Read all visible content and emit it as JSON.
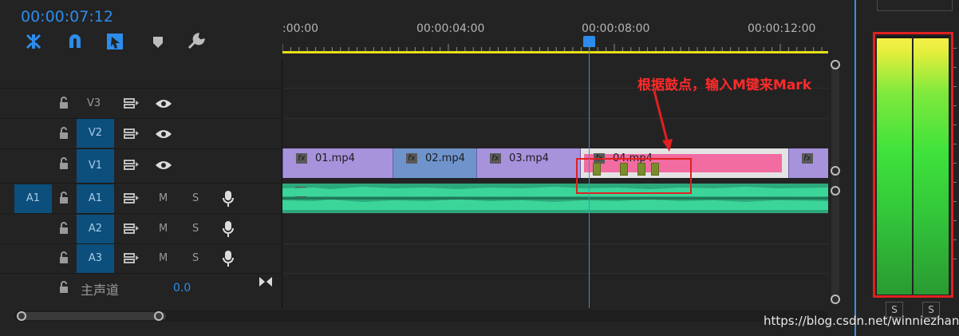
{
  "timecode": "00:00:07:12",
  "ruler": {
    "labels": [
      ":00:00",
      "00:00:04:00",
      "00:00:08:00",
      "00:00:12:00"
    ]
  },
  "tracks": {
    "video": [
      {
        "id": "V3"
      },
      {
        "id": "V2"
      },
      {
        "id": "V1"
      }
    ],
    "audio": [
      {
        "id": "A1",
        "source": "A1",
        "m": "M",
        "s": "S"
      },
      {
        "id": "A2",
        "m": "M",
        "s": "S"
      },
      {
        "id": "A3",
        "m": "M",
        "s": "S"
      }
    ],
    "master": {
      "label": "主声道",
      "value": "0.0"
    }
  },
  "clips": [
    {
      "name": "01.mp4",
      "fx": "fx"
    },
    {
      "name": "02.mp4",
      "fx": "fx"
    },
    {
      "name": "03.mp4",
      "fx": "fx"
    },
    {
      "name": "04.mp4",
      "fx": "fx"
    },
    {
      "name": "",
      "fx": "fx"
    }
  ],
  "audio_clip": {
    "fx": "fx"
  },
  "annotation": "根据鼓点，输入M键来Mark",
  "meters": {
    "solo": [
      "S",
      "S"
    ]
  },
  "watermark": "https://blog.csdn.net/winniezhang",
  "colors": {
    "accent": "#2d8ceb",
    "video_clip": "#a792dc",
    "selected_clip": "#f26ba1",
    "audio_clip": "#2ca97c",
    "annotation": "#ff2a2a"
  }
}
